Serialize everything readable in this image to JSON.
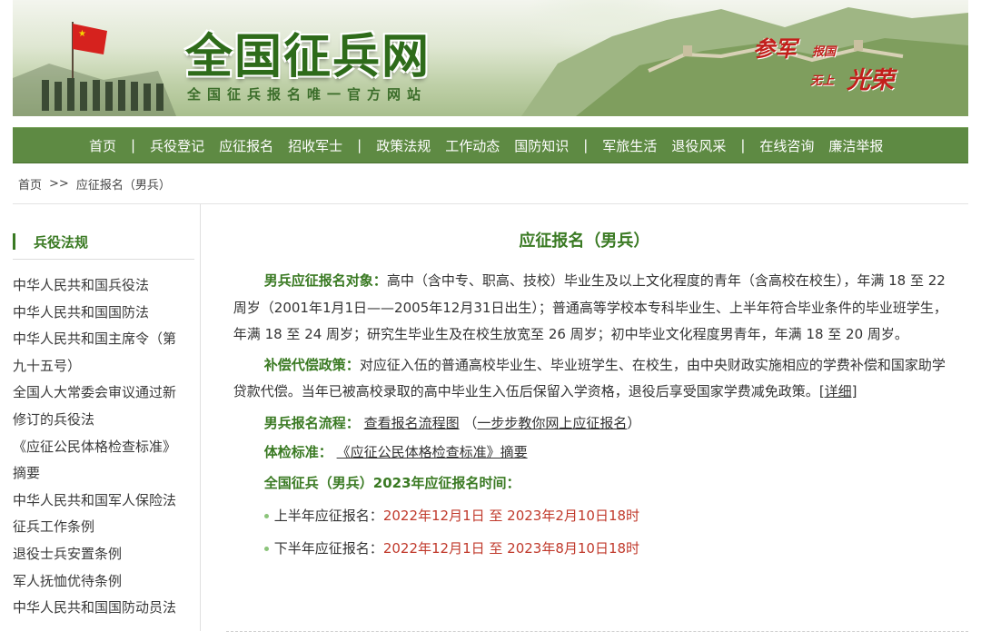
{
  "banner": {
    "title": "全国征兵网",
    "subtitle": "全国征兵报名唯一官方网站",
    "slogan_1": "参军",
    "slogan_2": "报国",
    "slogan_3": "无上",
    "slogan_4": "光荣"
  },
  "nav": {
    "items": [
      "首页",
      "|",
      "兵役登记",
      "应征报名",
      "招收军士",
      "|",
      "政策法规",
      "工作动态",
      "国防知识",
      "|",
      "军旅生活",
      "退役风采",
      "|",
      "在线咨询",
      "廉洁举报"
    ]
  },
  "breadcrumb": {
    "home": "首页",
    "sep": ">>",
    "current": "应征报名（男兵）"
  },
  "sidebar": {
    "heading": "兵役法规",
    "links": [
      "中华人民共和国兵役法",
      "中华人民共和国国防法",
      "中华人民共和国主席令（第",
      "九十五号）",
      "全国人大常委会审议通过新",
      "修订的兵役法",
      "《应征公民体格检查标准》",
      "摘要",
      "中华人民共和国军人保险法",
      "征兵工作条例",
      "退役士兵安置条例",
      "军人抚恤优待条例",
      "中华人民共和国国防动员法"
    ]
  },
  "main": {
    "title": "应征报名（男兵）",
    "p1_label": "男兵应征报名对象：",
    "p1_text": "高中（含中专、职高、技校）毕业生及以上文化程度的青年（含高校在校生），年满 18 至 22 周岁（2001年1月1日——2005年12月31日出生）；普通高等学校本专科毕业生、上半年符合毕业条件的毕业班学生，年满 18 至 24 周岁；研究生毕业生及在校生放宽至 26 周岁；初中毕业文化程度男青年，年满 18 至 20 周岁。",
    "p2_label": "补偿代偿政策：",
    "p2_text": "对应征入伍的普通高校毕业生、毕业班学生、在校生，由中央财政实施相应的学费补偿和国家助学贷款代偿。当年已被高校录取的高中毕业生入伍后保留入学资格，退役后享受国家学费减免政策。",
    "p2_link": "[详细]",
    "flow_label": "男兵报名流程：",
    "flow_link1": "查看报名流程图",
    "flow_open": "（",
    "flow_link2": "一步步教你网上应征报名",
    "flow_close": "）",
    "exam_label": "体检标准：",
    "exam_link": "《应征公民体格检查标准》摘要",
    "time_heading": "全国征兵（男兵）2023年应征报名时间：",
    "first_label": "上半年应征报名：",
    "first_time": "2022年12月1日 至 2023年2月10日18时",
    "second_label": "下半年应征报名：",
    "second_time": "2022年12月1日 至 2023年8月10日18时"
  },
  "colors": {
    "nav_bg": "#5e8a43",
    "accent_green": "#3a7a23",
    "time_red": "#c0392b"
  }
}
